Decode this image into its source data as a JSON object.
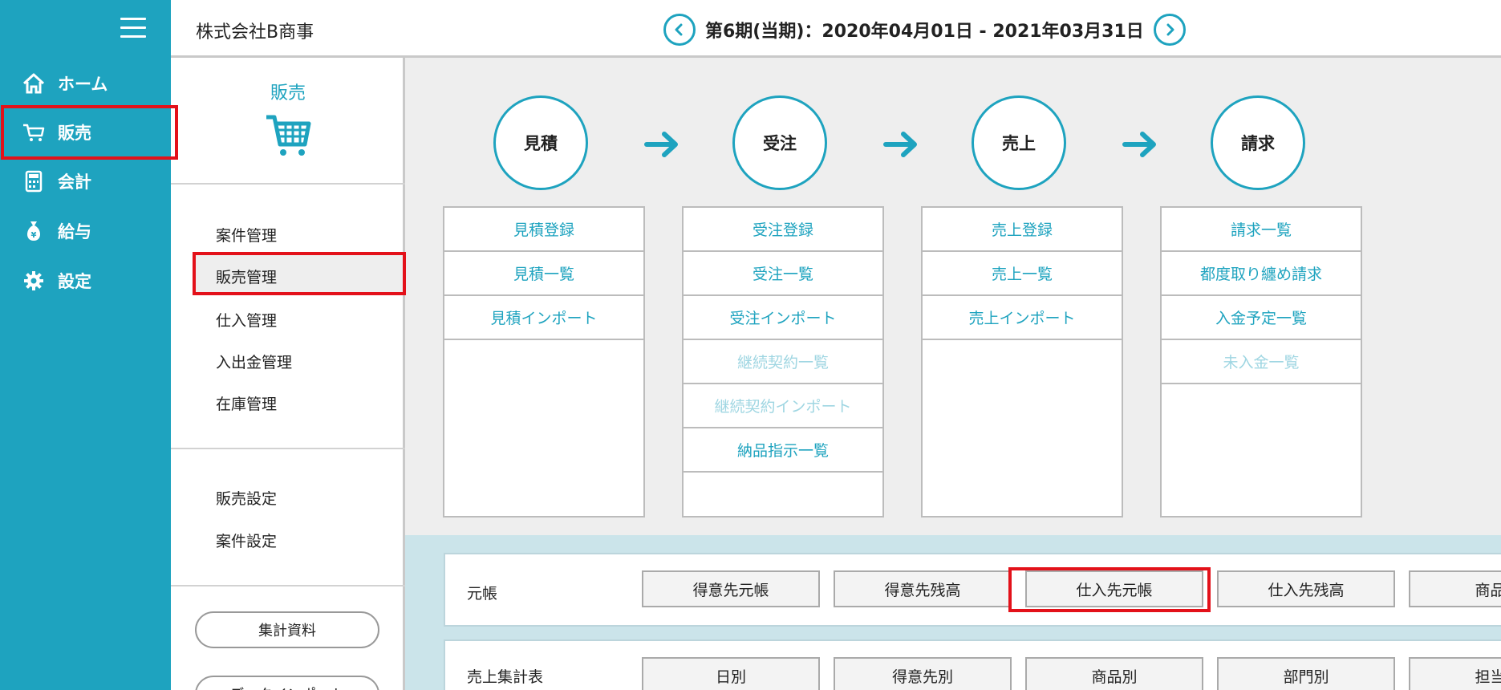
{
  "nav": {
    "items": [
      {
        "label": "ホーム",
        "icon": "home-icon"
      },
      {
        "label": "販売",
        "icon": "cart-icon"
      },
      {
        "label": "会計",
        "icon": "calculator-icon"
      },
      {
        "label": "給与",
        "icon": "money-bag-icon"
      },
      {
        "label": "設定",
        "icon": "gear-icon"
      }
    ]
  },
  "header": {
    "company": "株式会社B商事",
    "period": "第6期(当期)：2020年04月01日 - 2021年03月31日"
  },
  "subside": {
    "title": "販売",
    "items": [
      "案件管理",
      "販売管理",
      "仕入管理",
      "入出金管理",
      "在庫管理"
    ],
    "settings": [
      "販売設定",
      "案件設定"
    ],
    "buttons": [
      "集計資料",
      "データインポート"
    ]
  },
  "flow": {
    "steps": [
      {
        "label": "見積",
        "links": [
          {
            "label": "見積登録",
            "enabled": true
          },
          {
            "label": "見積一覧",
            "enabled": true
          },
          {
            "label": "見積インポート",
            "enabled": true
          }
        ]
      },
      {
        "label": "受注",
        "links": [
          {
            "label": "受注登録",
            "enabled": true
          },
          {
            "label": "受注一覧",
            "enabled": true
          },
          {
            "label": "受注インポート",
            "enabled": true
          },
          {
            "label": "継続契約一覧",
            "enabled": false
          },
          {
            "label": "継続契約インポート",
            "enabled": false
          },
          {
            "label": "納品指示一覧",
            "enabled": true
          }
        ]
      },
      {
        "label": "売上",
        "links": [
          {
            "label": "売上登録",
            "enabled": true
          },
          {
            "label": "売上一覧",
            "enabled": true
          },
          {
            "label": "売上インポート",
            "enabled": true
          }
        ]
      },
      {
        "label": "請求",
        "links": [
          {
            "label": "請求一覧",
            "enabled": true
          },
          {
            "label": "都度取り纏め請求",
            "enabled": true
          },
          {
            "label": "入金予定一覧",
            "enabled": true
          },
          {
            "label": "未入金一覧",
            "enabled": false
          }
        ]
      }
    ]
  },
  "reports": {
    "ledger": {
      "label": "元帳",
      "buttons": [
        "得意先元帳",
        "得意先残高",
        "仕入先元帳",
        "仕入先残高",
        "商品元"
      ]
    },
    "sales": {
      "label": "売上集計表",
      "buttons": [
        "日別",
        "得意先別",
        "商品別",
        "部門別",
        "担当者"
      ]
    }
  },
  "colors": {
    "accent": "#1ea3bf",
    "highlight": "#e3111a",
    "disabled_link": "#9fd6e2"
  }
}
